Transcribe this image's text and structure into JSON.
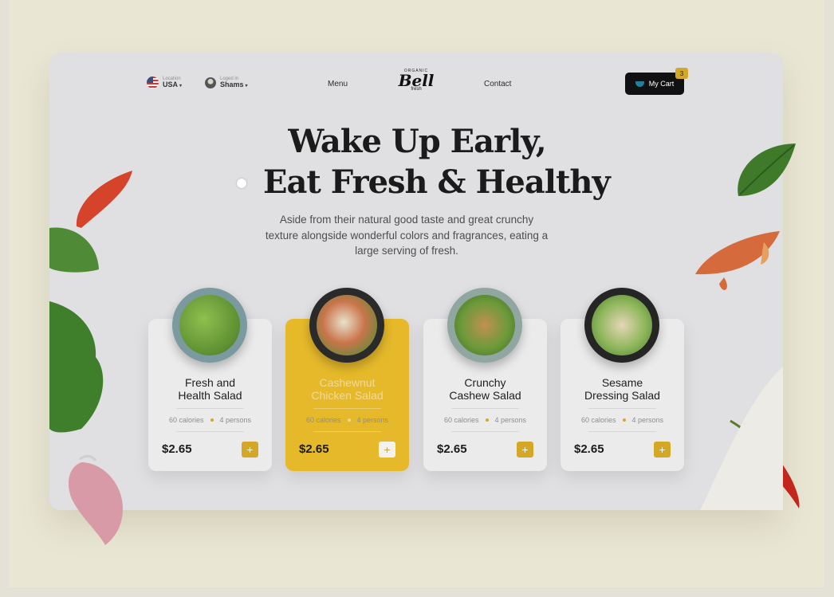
{
  "nav": {
    "location_caption": "Location",
    "location_value": "USA",
    "user_caption": "Loged in",
    "user_name": "Shams",
    "menu_label": "Menu",
    "contact_label": "Contact",
    "logo_top": "ORGANIC",
    "logo_main": "Bell",
    "logo_sub": "fresh",
    "cart_label": "My Cart",
    "cart_count": "3"
  },
  "hero": {
    "title_line1": "Wake Up Early,",
    "title_line2": "Eat Fresh & Healthy",
    "description": "Aside from their natural good taste and great crunchy texture alongside wonderful colors and fragrances, eating a large serving of fresh."
  },
  "products": [
    {
      "title_line1": "Fresh and",
      "title_line2": "Health Salad",
      "calories": "60 calories",
      "persons": "4 persons",
      "price": "$2.65",
      "add": "+"
    },
    {
      "title_line1": "Cashewnut",
      "title_line2": "Chicken Salad",
      "calories": "60 calories",
      "persons": "4 persons",
      "price": "$2.65",
      "add": "+"
    },
    {
      "title_line1": "Crunchy",
      "title_line2": "Cashew Salad",
      "calories": "60 calories",
      "persons": "4 persons",
      "price": "$2.65",
      "add": "+"
    },
    {
      "title_line1": "Sesame",
      "title_line2": "Dressing Salad",
      "calories": "60 calories",
      "persons": "4 persons",
      "price": "$2.65",
      "add": "+"
    }
  ],
  "colors": {
    "accent": "#d4a826",
    "active_card": "#e6b92a",
    "cart_button": "#111111"
  },
  "icons": {
    "location": "us-flag-icon",
    "user": "avatar-icon",
    "cart": "bowl-icon",
    "add": "plus-icon"
  }
}
